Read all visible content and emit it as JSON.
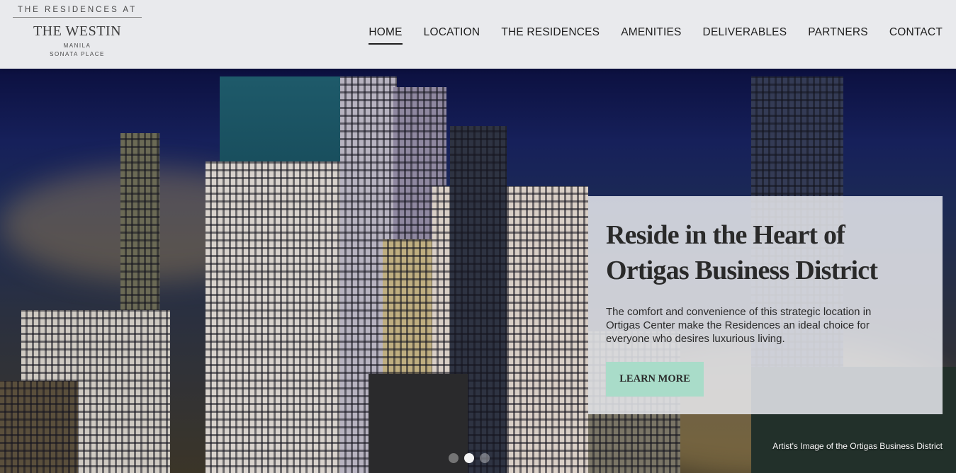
{
  "logo": {
    "top": "THE RESIDENCES AT",
    "brand": "THE WESTIN",
    "city": "MANILA",
    "place": "SONATA PLACE"
  },
  "nav": {
    "items": [
      {
        "label": "HOME",
        "active": true
      },
      {
        "label": "LOCATION"
      },
      {
        "label": "THE RESIDENCES"
      },
      {
        "label": "AMENITIES"
      },
      {
        "label": "DELIVERABLES"
      },
      {
        "label": "PARTNERS"
      },
      {
        "label": "CONTACT"
      }
    ]
  },
  "hero": {
    "title_line1": "Reside in the Heart of",
    "title_line2": "Ortigas Business District",
    "text": "The comfort and convenience of this strategic location in Ortigas Center make the Residences an ideal choice for everyone who desires luxurious living.",
    "button": "LEARN MORE",
    "caption": "Artist's Image of the Ortigas Business District",
    "slide_count": 3,
    "active_slide": 2
  },
  "colors": {
    "header_bg": "#e9eaed",
    "button_bg": "#a9dcc9",
    "card_bg": "#e8e9ee"
  }
}
